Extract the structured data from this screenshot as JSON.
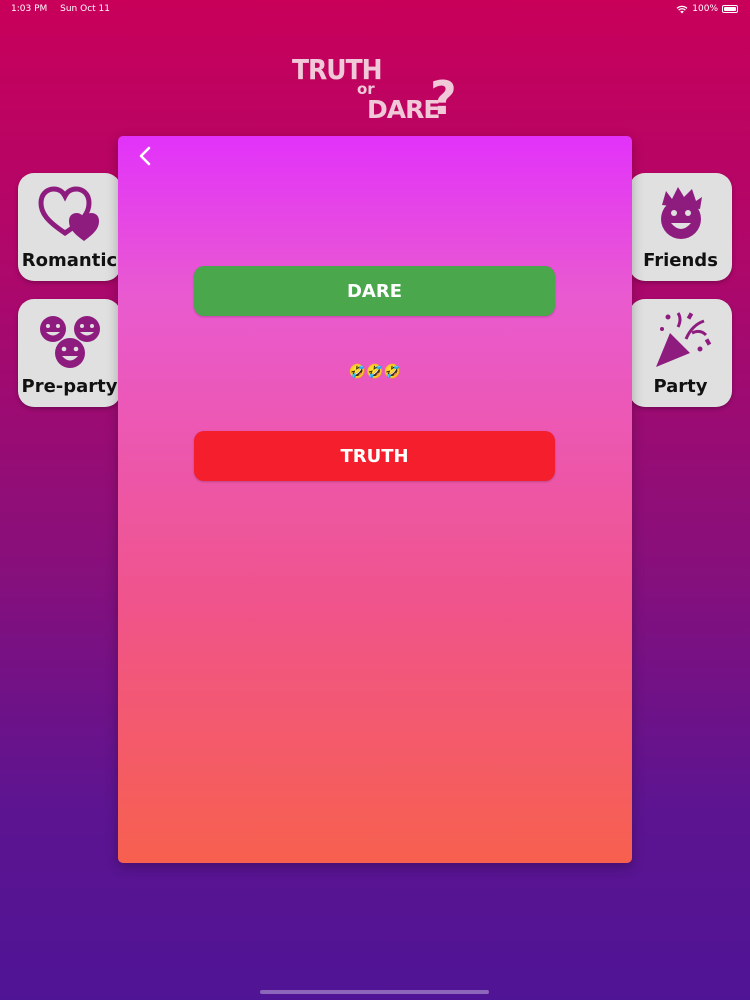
{
  "status": {
    "time": "1:03 PM",
    "date": "Sun Oct 11",
    "battery": "100%"
  },
  "logo": {
    "line1": "TRUTH",
    "line2": "or",
    "line3": "DARE",
    "mark": "?"
  },
  "categories": {
    "romantic": {
      "label": "Romantic",
      "icon": "hearts-icon"
    },
    "preparty": {
      "label": "Pre-party",
      "icon": "faces-icon"
    },
    "friends": {
      "label": "Friends",
      "icon": "face-icon"
    },
    "party": {
      "label": "Party",
      "icon": "party-popper-icon"
    }
  },
  "modal": {
    "dare_label": "DARE",
    "truth_label": "TRUTH",
    "emoji": "🤣🤣🤣"
  },
  "colors": {
    "accent": "#8e1c7f",
    "dare": "#4aa74c",
    "truth": "#f41e2c"
  }
}
